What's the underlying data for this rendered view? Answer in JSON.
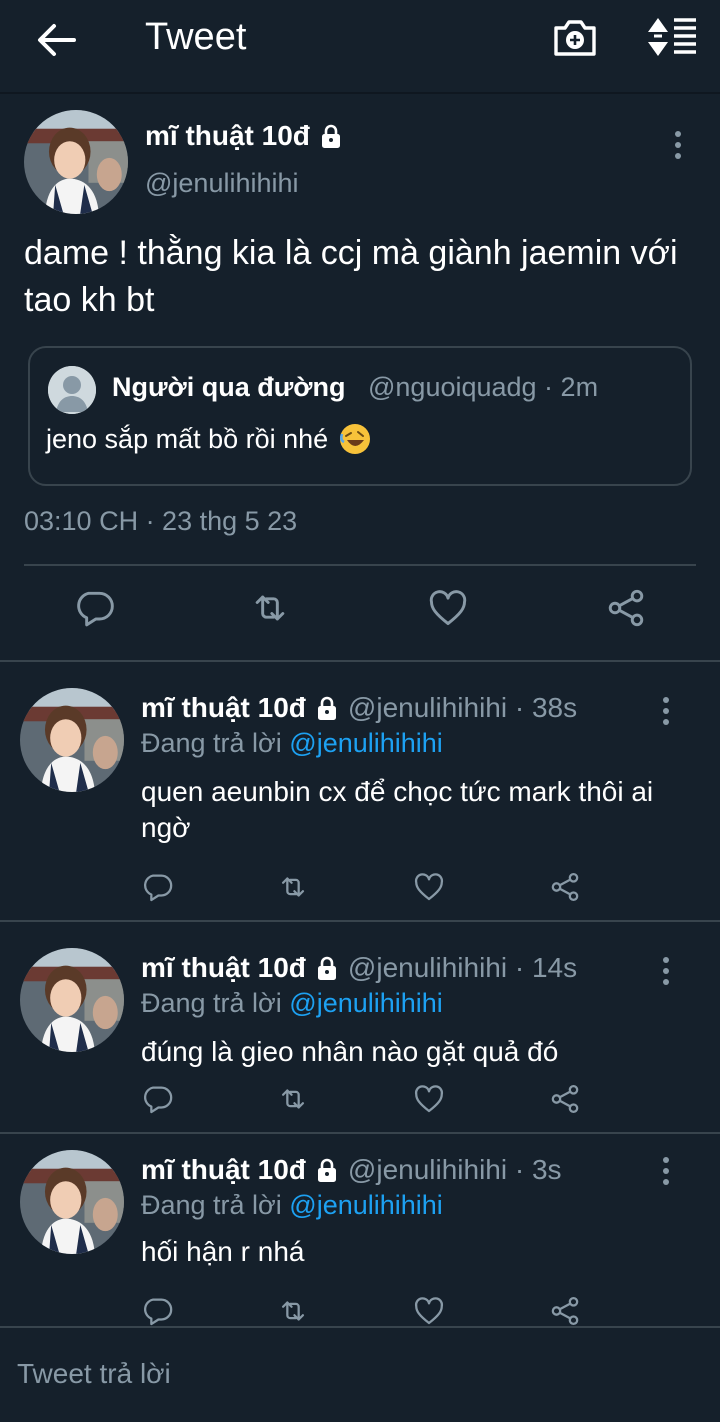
{
  "header": {
    "title": "Tweet",
    "back_icon": "arrow-left-icon",
    "camera_icon": "camera-plus-icon",
    "sort_icon": "sort-icon"
  },
  "main_tweet": {
    "name": "mĩ thuật 10đ",
    "handle": "@jenulihihihi",
    "text": "dame ! thằng kia là ccj mà giành jaemin với tao kh bt",
    "quote": {
      "name": "Người qua đường",
      "handle_time": "@nguoiquadg · 2m",
      "text": "jeno sắp mất bồ rồi nhé",
      "emoji": "🤣"
    },
    "timestamp": "03:10 CH · 23 thg 5 23"
  },
  "replies": [
    {
      "name": "mĩ thuật 10đ",
      "handle_time": "@jenulihihihi · 38s",
      "replying_prefix": "Đang trả lời",
      "mention": "@jenulihihihi",
      "text": "quen aeunbin cx để chọc tức mark thôi ai ngờ"
    },
    {
      "name": "mĩ thuật 10đ",
      "handle_time": "@jenulihihihi · 14s",
      "replying_prefix": "Đang trả lời",
      "mention": "@jenulihihihi",
      "text": "đúng là gieo nhân nào gặt quả đó"
    },
    {
      "name": "mĩ thuật 10đ",
      "handle_time": "@jenulihihihi · 3s",
      "replying_prefix": "Đang trả lời",
      "mention": "@jenulihihihi",
      "text": "hối hận r nhá"
    }
  ],
  "compose": {
    "placeholder": "Tweet trả lời"
  },
  "colors": {
    "background": "#15202b",
    "secondary_text": "#8899a6",
    "accent": "#1da1f2",
    "border": "#38444d"
  }
}
